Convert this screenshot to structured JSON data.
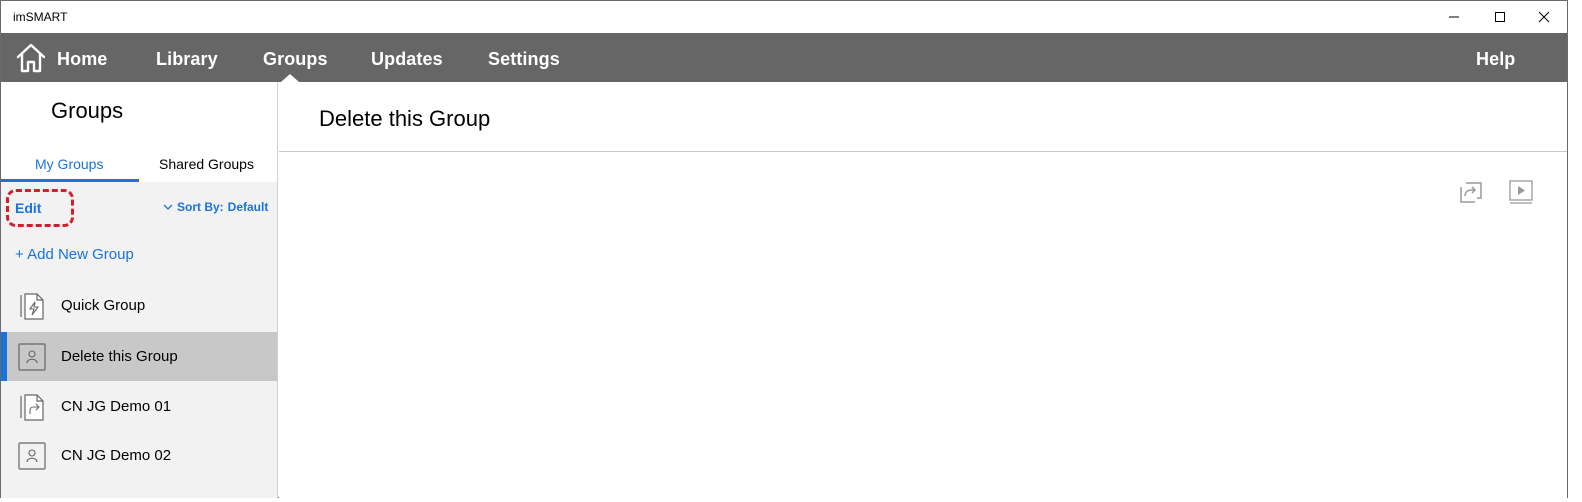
{
  "app": {
    "title": "imSMART"
  },
  "nav": {
    "items": [
      {
        "label": "Home"
      },
      {
        "label": "Library"
      },
      {
        "label": "Groups"
      },
      {
        "label": "Updates"
      },
      {
        "label": "Settings"
      }
    ],
    "help": "Help",
    "active": "Groups"
  },
  "sidebar": {
    "title": "Groups",
    "tabs": [
      {
        "label": "My Groups",
        "active": true
      },
      {
        "label": "Shared Groups",
        "active": false
      }
    ],
    "edit_label": "Edit",
    "sort_label": "Sort By:",
    "sort_value": "Default",
    "add_label": "+ Add New Group",
    "groups": [
      {
        "label": "Quick Group",
        "icon": "quick-group-icon"
      },
      {
        "label": "Delete this Group",
        "icon": "person-group-icon",
        "selected": true
      },
      {
        "label": "CN JG Demo 01",
        "icon": "shared-group-icon"
      },
      {
        "label": "CN JG Demo 02",
        "icon": "person-group-icon"
      }
    ]
  },
  "main": {
    "title": "Delete this Group"
  },
  "colors": {
    "accent": "#1a73d9",
    "navbar": "#666666",
    "highlight": "#d0202e",
    "selected_row": "#c8c8c8"
  }
}
